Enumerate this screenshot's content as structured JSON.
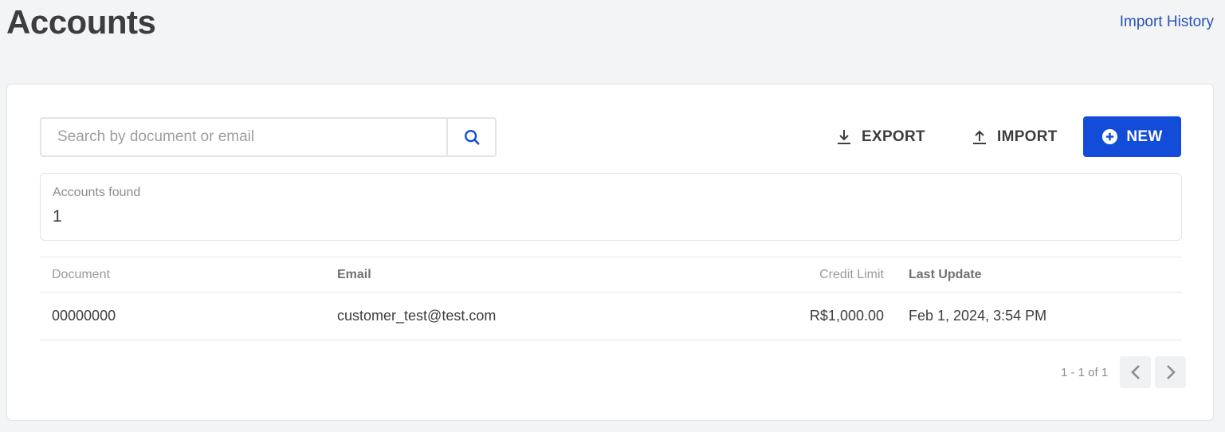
{
  "header": {
    "title": "Accounts",
    "import_history_label": "Import History"
  },
  "toolbar": {
    "search_placeholder": "Search by document or email",
    "search_value": "",
    "export_label": "EXPORT",
    "import_label": "IMPORT",
    "new_label": "NEW"
  },
  "summary": {
    "label": "Accounts found",
    "count": "1"
  },
  "table": {
    "columns": [
      "Document",
      "Email",
      "Credit Limit",
      "Last Update"
    ],
    "rows": [
      {
        "document": "00000000",
        "email": "customer_test@test.com",
        "credit_limit": "R$1,000.00",
        "last_update": "Feb 1, 2024, 3:54 PM"
      }
    ]
  },
  "pagination": {
    "info": "1 - 1 of 1"
  },
  "colors": {
    "primary": "#134cd8",
    "link": "#2953b2",
    "background": "#f3f4f6",
    "border": "#e3e4e6"
  },
  "icons": {
    "search": "search-icon",
    "export": "download-icon",
    "import": "upload-icon",
    "new": "plus-circle-icon",
    "prev": "chevron-left-icon",
    "next": "chevron-right-icon"
  }
}
